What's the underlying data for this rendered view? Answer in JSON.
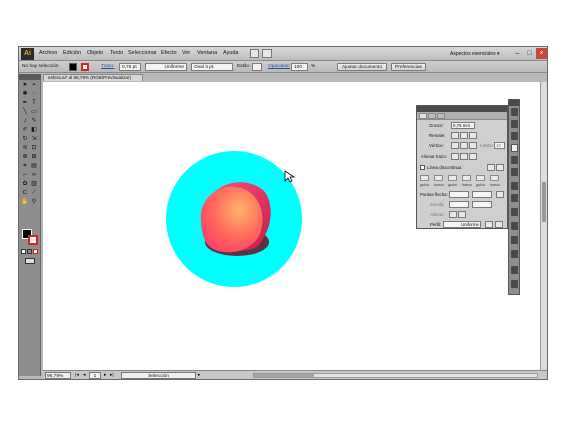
{
  "menubar": {
    "logo": "Ai",
    "items": [
      "Archivo",
      "Edición",
      "Objeto",
      "Texto",
      "Seleccionar",
      "Efecto",
      "Ver",
      "Ventana",
      "Ayuda"
    ],
    "workspace": "Aspectos esenciales",
    "workspace_arrow": "▾"
  },
  "controlbar": {
    "selection_status": "No hay selección",
    "stroke_link": "Trazo:",
    "stroke_weight": "0,75 pt",
    "stroke_profile": "Uniforme",
    "brush": "Oval 3 pt.",
    "style_label": "Estilo:",
    "opacity_link": "Opacidad:",
    "opacity_value": "100",
    "percent": "%",
    "align_doc_button": "Ajustar documento",
    "prefs_button": "Preferencias"
  },
  "document": {
    "tab_title": "esfera.ai* al 96,79% (RGB/Previsualizar)"
  },
  "status": {
    "zoom": "96,79%",
    "page": "1",
    "tool": "Selección"
  },
  "stroke_panel": {
    "weight_label": "Grosor:",
    "weight_value": "0,75 mm",
    "cap_label": "Remate:",
    "corner_label": "Vértice:",
    "limit_label": "Límite:",
    "limit_value": "10",
    "align_label": "Alinear trazo:",
    "dashed_label": "Línea discontinua",
    "dash_sublabels": [
      "guión",
      "hueco",
      "guión",
      "hueco",
      "guión",
      "hueco"
    ],
    "arrows_label": "Puntas flecha:",
    "scale_label": "Escala:",
    "align2_label": "Alinear:",
    "profile_label": "Perfil:",
    "profile_value": "Uniforme"
  },
  "colors": {
    "cyan_circle": "#00ffff",
    "sphere_light": "#ffb56b",
    "sphere_mid": "#ff4f6a",
    "sphere_dark": "#7a1030",
    "stroke_swatch": "#dd2222"
  },
  "icons": {
    "cursor": "arrow-cursor-icon"
  }
}
